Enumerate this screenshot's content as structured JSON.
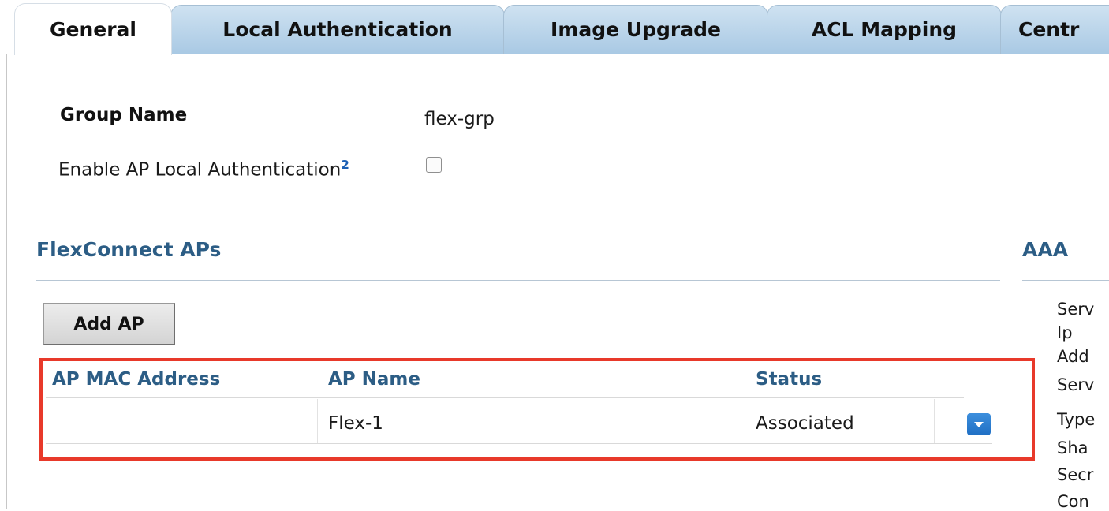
{
  "tabs": [
    {
      "label": "General",
      "active": true
    },
    {
      "label": "Local Authentication",
      "active": false
    },
    {
      "label": "Image Upgrade",
      "active": false
    },
    {
      "label": "ACL Mapping",
      "active": false
    },
    {
      "label": "Centr",
      "active": false
    }
  ],
  "general": {
    "group_name_label": "Group Name",
    "group_name_value": "flex-grp",
    "enable_local_auth_label": "Enable AP Local Authentication",
    "enable_local_auth_footnote": "2",
    "enable_local_auth_checked": false
  },
  "flexconnect": {
    "title": "FlexConnect APs",
    "add_button": "Add AP",
    "columns": [
      "AP MAC Address",
      "AP Name",
      "Status"
    ],
    "rows": [
      {
        "mac": "",
        "name": "Flex-1",
        "status": "Associated"
      }
    ]
  },
  "aaa": {
    "title": "AAA",
    "lines": [
      "Serv",
      "Ip",
      "Add",
      "Serv",
      "Type",
      "Sha",
      "Secr",
      "Con"
    ]
  },
  "colors": {
    "accent": "#2c5d85",
    "tab_gradient_top": "#cfe2f1",
    "tab_gradient_bottom": "#a9c9e4",
    "highlight": "#e8392a",
    "dropdown": "#1f6fc4"
  },
  "icons": {
    "dropdown": "chevron-down-icon"
  }
}
